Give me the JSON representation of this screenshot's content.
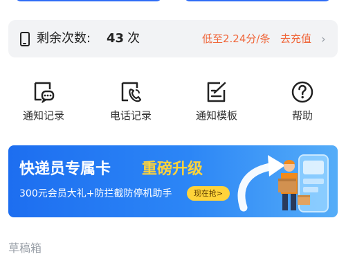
{
  "quota": {
    "label": "剩余次数:",
    "count": "43",
    "unit": "次",
    "price": "低至2.24分/条",
    "recharge": "去充值",
    "chevron": "›",
    "accent_color": "#f0663a"
  },
  "grid": [
    {
      "label": "通知记录",
      "icon": "message-record-icon"
    },
    {
      "label": "电话记录",
      "icon": "phone-record-icon"
    },
    {
      "label": "通知模板",
      "icon": "template-icon"
    },
    {
      "label": "帮助",
      "icon": "help-icon"
    }
  ],
  "banner": {
    "title_main": "快递员专属卡",
    "title_highlight": "重磅升级",
    "subtitle": "300元会员大礼+防拦截防停机助手",
    "cta": "现在抢>",
    "highlight_color": "#ffd33a"
  },
  "drafts": {
    "title": "草稿箱"
  }
}
